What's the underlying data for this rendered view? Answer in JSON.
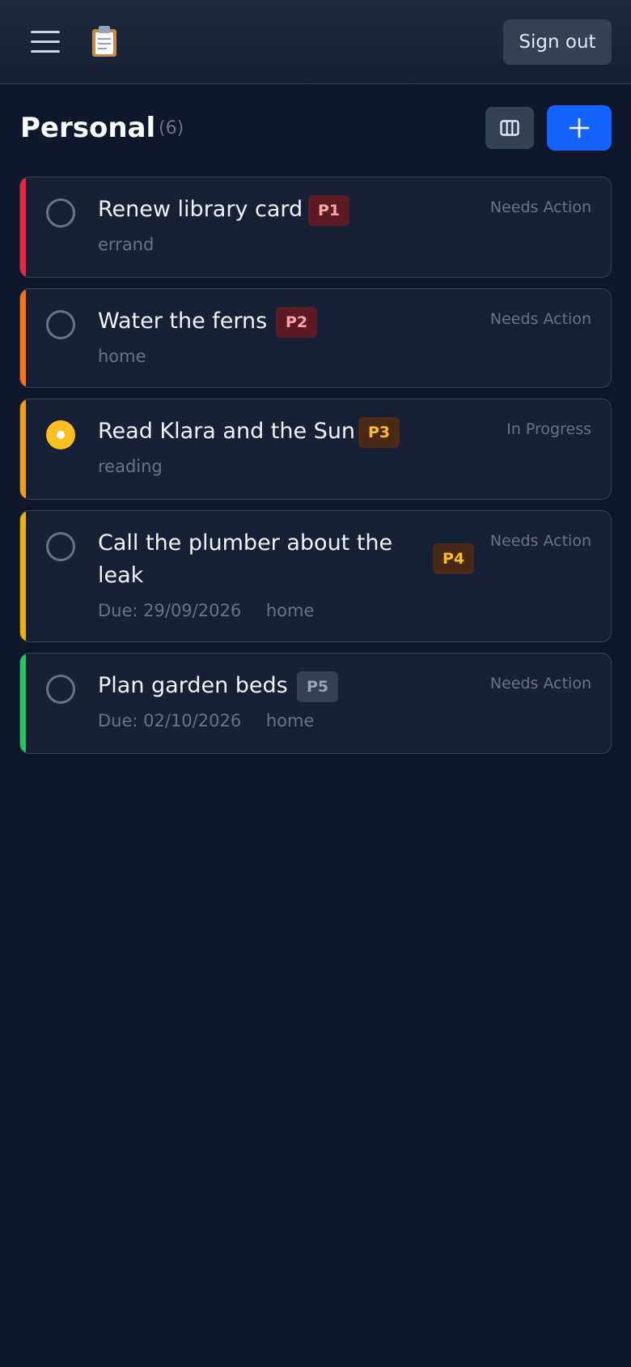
{
  "header": {
    "menu_icon": "hamburger-menu-icon",
    "logo_icon": "clipboard-icon",
    "signout_label": "Sign out"
  },
  "list": {
    "title": "Personal",
    "count": "(6)",
    "board_icon": "columns-icon",
    "add_icon": "plus-icon"
  },
  "tasks": [
    {
      "title": "Renew library card",
      "priority": "P1",
      "status": "Needs Action",
      "due": "",
      "tag": "errand",
      "bar_color": "#ef233c",
      "badge_bg": "#5b1a24",
      "badge_fg": "#fca5a5",
      "in_progress": false
    },
    {
      "title": "Water the ferns",
      "priority": "P2",
      "status": "Needs Action",
      "due": "",
      "tag": "home",
      "bar_color": "#f97316",
      "badge_bg": "#5b1a24",
      "badge_fg": "#fca5a5",
      "in_progress": false
    },
    {
      "title": "Read Klara and the Sun",
      "priority": "P3",
      "status": "In Progress",
      "due": "",
      "tag": "reading",
      "bar_color": "#f59e0b",
      "badge_bg": "#4a2a17",
      "badge_fg": "#fbbf24",
      "in_progress": true
    },
    {
      "title_line1": "Call the plumber about the",
      "title_line2": "leak",
      "priority": "P4",
      "status": "Needs Action",
      "due": "Due: 29/09/2026",
      "tag": "home",
      "bar_color": "#eab308",
      "badge_bg": "#4a2a17",
      "badge_fg": "#fbbf24",
      "in_progress": false
    },
    {
      "title": "Plan garden beds",
      "priority": "P5",
      "status": "Needs Action",
      "due": "Due: 02/10/2026",
      "tag": "home",
      "bar_color": "#22c55e",
      "badge_bg": "#334155",
      "badge_fg": "#94a3b8",
      "in_progress": false
    }
  ]
}
